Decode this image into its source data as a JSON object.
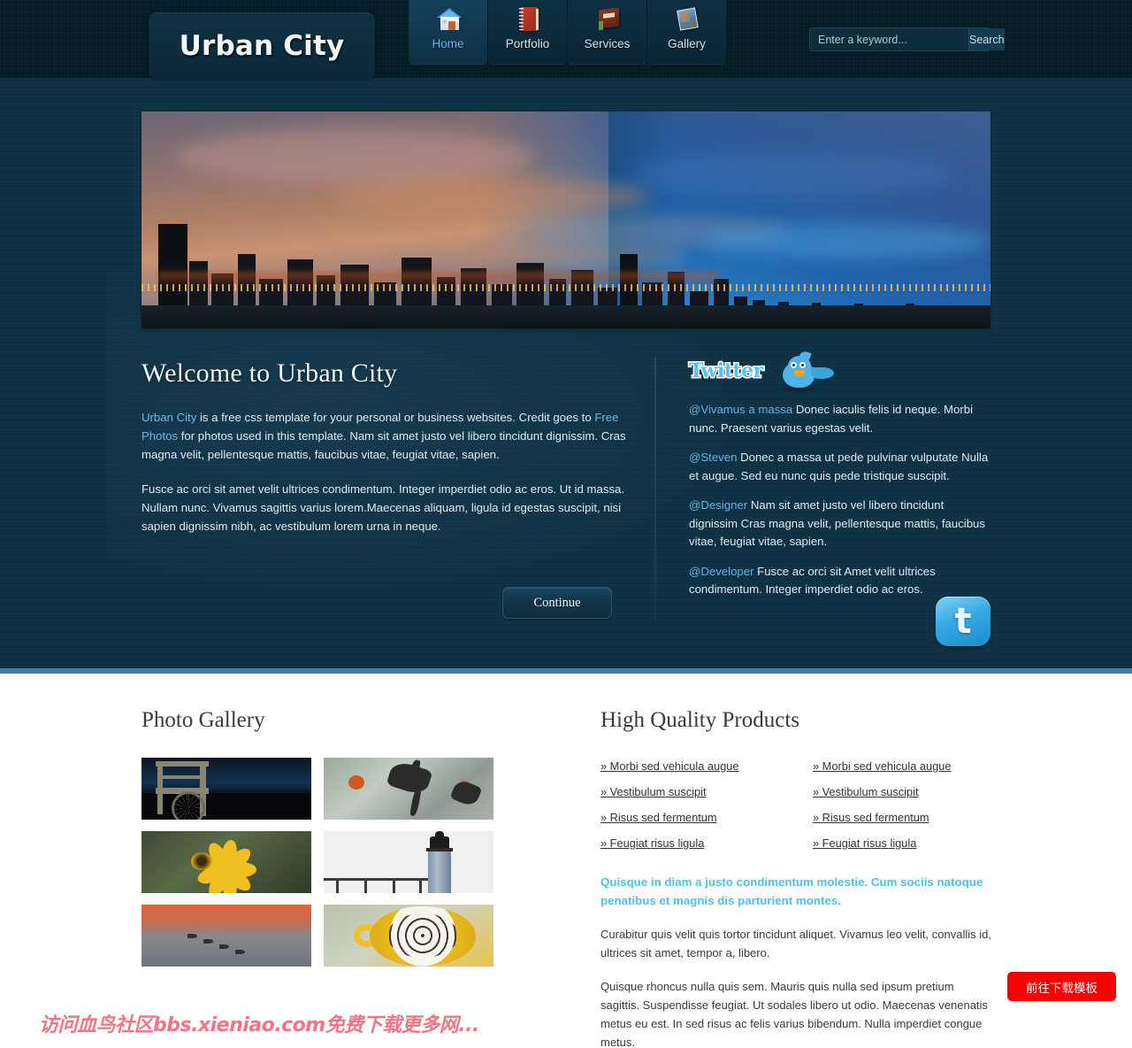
{
  "header": {
    "logo": "Urban City",
    "nav": [
      {
        "label": "Home",
        "icon": "house-icon",
        "active": true
      },
      {
        "label": "Portfolio",
        "icon": "notebook-icon",
        "active": false
      },
      {
        "label": "Services",
        "icon": "book-icon",
        "active": false
      },
      {
        "label": "Gallery",
        "icon": "magazine-icon",
        "active": false
      }
    ],
    "search": {
      "placeholder": "Enter a keyword...",
      "value": "",
      "button": "Search"
    }
  },
  "hero": {
    "banner_alt": "city-skyline-at-dusk",
    "heading": "Welcome to Urban City",
    "paragraph1_pre": "",
    "link1": "Urban City",
    "paragraph1_mid": " is a free css template for your personal or business websites. Credit goes to ",
    "link2": "Free Photos",
    "paragraph1_post": " for photos used in this template. Nam sit amet justo vel libero tincidunt dignissim. Cras magna velit, pellentesque mattis, faucibus vitae, feugiat vitae, sapien.",
    "paragraph2": "Fusce ac orci sit amet velit ultrices condimentum. Integer imperdiet odio ac eros. Ut id massa. Nullam nunc. Vivamus sagittis varius lorem.Maecenas aliquam, ligula id egestas suscipit, nisi sapien dignissim nibh, ac vestibulum lorem urna in neque.",
    "continue_label": "Continue"
  },
  "twitter": {
    "logo_text": "Twitter",
    "bird_icon": "twitter-bird-icon",
    "badge_icon": "twitter-t-badge-icon",
    "badge_letter": "t",
    "tweets": [
      {
        "handle": "@Vivamus a massa",
        "text": " Donec iaculis felis id neque. Morbi nunc. Praesent varius egestas velit."
      },
      {
        "handle": "@Steven",
        "text": " Donec a massa ut pede pulvinar vulputate Nulla et augue. Sed eu nunc quis pede tristique suscipit."
      },
      {
        "handle": "@Designer",
        "text": " Nam sit amet justo vel libero tincidunt dignissim Cras magna velit, pellentesque mattis, faucibus vitae, feugiat vitae, sapien."
      },
      {
        "handle": "@Developer",
        "text": " Fusce ac orci sit Amet velit ultrices condimentum. Integer imperdiet odio ac eros."
      }
    ]
  },
  "gallery": {
    "heading": "Photo Gallery",
    "thumbs": [
      "night-cart-wagon-wheel-photo",
      "angelfish-aquarium-photo",
      "yellow-flower-photo",
      "lighthouse-pier-photo",
      "jets-formation-sunset-photo",
      "coffee-cup-spiral-photo"
    ]
  },
  "products": {
    "heading": "High Quality Products",
    "left_links": [
      "» Morbi sed vehicula augue",
      "» Vestibulum suscipit",
      "» Risus sed fermentum",
      "» Feugiat risus ligula"
    ],
    "right_links": [
      "» Morbi sed vehicula augue",
      "» Vestibulum suscipit",
      "» Risus sed fermentum",
      "» Feugiat risus ligula"
    ],
    "highlight": "Quisque in diam a justo condimentum molestie. Cum sociis natoque penatibus et magnis dis parturient montes.",
    "paragraph1": "Curabitur quis velit quis tortor tincidunt aliquet. Vivamus leo velit, convallis id, ultrices sit amet, tempor a, libero.",
    "paragraph2": "Quisque rhoncus nulla quis sem. Mauris quis nulla sed ipsum pretium sagittis. Suspendisse feugiat. Ut sodales libero ut odio. Maecenas venenatis metus eu est. In sed risus ac felis varius bibendum. Nulla imperdiet congue metus."
  },
  "overlay": {
    "download_button": "前往下载模板",
    "watermark": "访问血鸟社区bbs.xieniao.com免费下载更多网..."
  },
  "colors": {
    "header_bg": "#041b26",
    "hero_bg": "#0e3144",
    "accent_line": "#3b7da6",
    "link_blue": "#6fb6e8",
    "highlight_cyan": "#4fc0e8",
    "download_red": "#fb0000",
    "watermark_pink": "#f2556a"
  }
}
